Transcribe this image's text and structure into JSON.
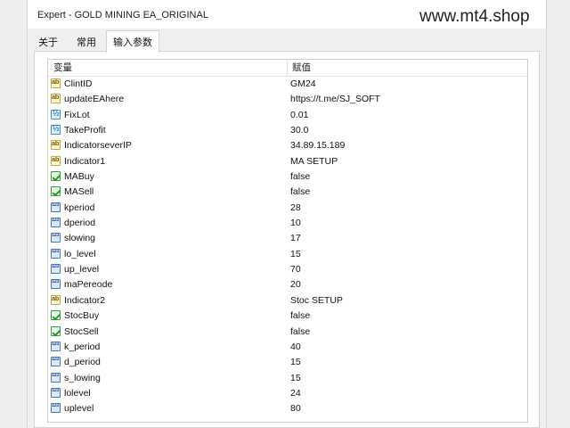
{
  "window": {
    "title": "Expert - GOLD MINING EA_ORIGINAL",
    "watermark": "www.mt4.shop"
  },
  "tabs": [
    {
      "label": "关于",
      "active": false
    },
    {
      "label": "常用",
      "active": false
    },
    {
      "label": "输入参数",
      "active": true
    }
  ],
  "grid": {
    "headers": {
      "variable": "变量",
      "value": "赋值"
    },
    "rows": [
      {
        "name": "ClintID",
        "value": "GM24",
        "icon": "string-type-icon"
      },
      {
        "name": "updateEAhere",
        "value": "https://t.me/SJ_SOFT",
        "icon": "string-type-icon"
      },
      {
        "name": "FixLot",
        "value": "0.01",
        "icon": "double-type-icon"
      },
      {
        "name": "TakeProfit",
        "value": "30.0",
        "icon": "double-type-icon"
      },
      {
        "name": "IndicatorseverIP",
        "value": "34.89.15.189",
        "icon": "string-type-icon"
      },
      {
        "name": "Indicator1",
        "value": "MA SETUP",
        "icon": "string-type-icon"
      },
      {
        "name": "MABuy",
        "value": "false",
        "icon": "bool-type-icon"
      },
      {
        "name": "MASell",
        "value": "false",
        "icon": "bool-type-icon"
      },
      {
        "name": "kperiod",
        "value": "28",
        "icon": "int-type-icon"
      },
      {
        "name": "dperiod",
        "value": "10",
        "icon": "int-type-icon"
      },
      {
        "name": "slowing",
        "value": "17",
        "icon": "int-type-icon"
      },
      {
        "name": "lo_level",
        "value": "15",
        "icon": "int-type-icon"
      },
      {
        "name": "up_level",
        "value": "70",
        "icon": "int-type-icon"
      },
      {
        "name": "maPereode",
        "value": "20",
        "icon": "int-type-icon"
      },
      {
        "name": "Indicator2",
        "value": "Stoc SETUP",
        "icon": "string-type-icon"
      },
      {
        "name": "StocBuy",
        "value": "false",
        "icon": "bool-type-icon"
      },
      {
        "name": "StocSell",
        "value": "false",
        "icon": "bool-type-icon"
      },
      {
        "name": "k_period",
        "value": "40",
        "icon": "int-type-icon"
      },
      {
        "name": "d_period",
        "value": "15",
        "icon": "int-type-icon"
      },
      {
        "name": "s_lowing",
        "value": "15",
        "icon": "int-type-icon"
      },
      {
        "name": "lolevel",
        "value": "24",
        "icon": "int-type-icon"
      },
      {
        "name": "uplevel",
        "value": "80",
        "icon": "int-type-icon"
      }
    ]
  }
}
